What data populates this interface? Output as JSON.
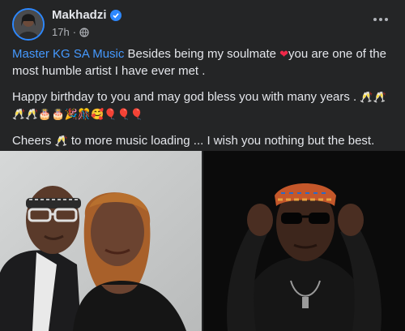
{
  "post": {
    "author": "Makhadzi",
    "time": "17h",
    "separator": "·",
    "mention": "Master KG SA Music",
    "line1_after_mention": " Besides being my soulmate ",
    "heart_emoji": "❤",
    "line1_rest": "you are one of the most humble artist I have ever met .",
    "line2": "Happy birthday to you and may god bless you with many years .",
    "line2_emojis": "🥂🥂🥂🥂🎂🎂🎉🎊🥰🎈🎈🎈",
    "line3_start": "Cheers ",
    "cheers_emoji": "🥂",
    "line3_rest": " to more music loading ... I wish you nothing but the best."
  },
  "icons": {
    "verified": "verified-badge-icon",
    "audience": "globe-icon",
    "more": "more-options-icon"
  },
  "colors": {
    "background": "#242526",
    "text": "#e4e6eb",
    "secondary_text": "#b0b3b8",
    "link": "#4599ff",
    "verified": "#2d88ff"
  }
}
